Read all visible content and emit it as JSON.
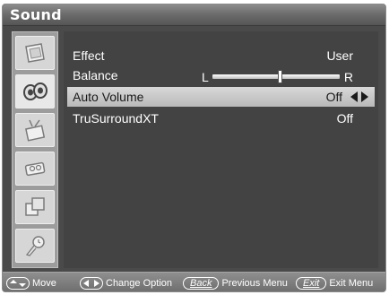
{
  "title": "Sound",
  "sidebar": {
    "icons": [
      {
        "name": "picture-icon"
      },
      {
        "name": "sound-icon",
        "active": true
      },
      {
        "name": "channel-icon"
      },
      {
        "name": "setup-icon"
      },
      {
        "name": "input-icon"
      },
      {
        "name": "support-icon"
      }
    ]
  },
  "menu": {
    "items": [
      {
        "label": "Effect",
        "value": "User"
      },
      {
        "label": "Balance",
        "left": "L",
        "right": "R",
        "position": 0.53
      },
      {
        "label": "Auto Volume",
        "value": "Off",
        "selected": true
      },
      {
        "label": "TruSurroundXT",
        "value": "Off"
      }
    ]
  },
  "helpbar": {
    "move": "Move",
    "change_option": "Change Option",
    "back_key": "Back",
    "previous_menu": "Previous Menu",
    "exit_key": "Exit",
    "exit_menu": "Exit Menu"
  },
  "colors": {
    "panel_bg": "#434343",
    "sidebar_bg": "#9c9c9c",
    "selected_row": "#c4c4c4",
    "text": "#ffffff"
  }
}
